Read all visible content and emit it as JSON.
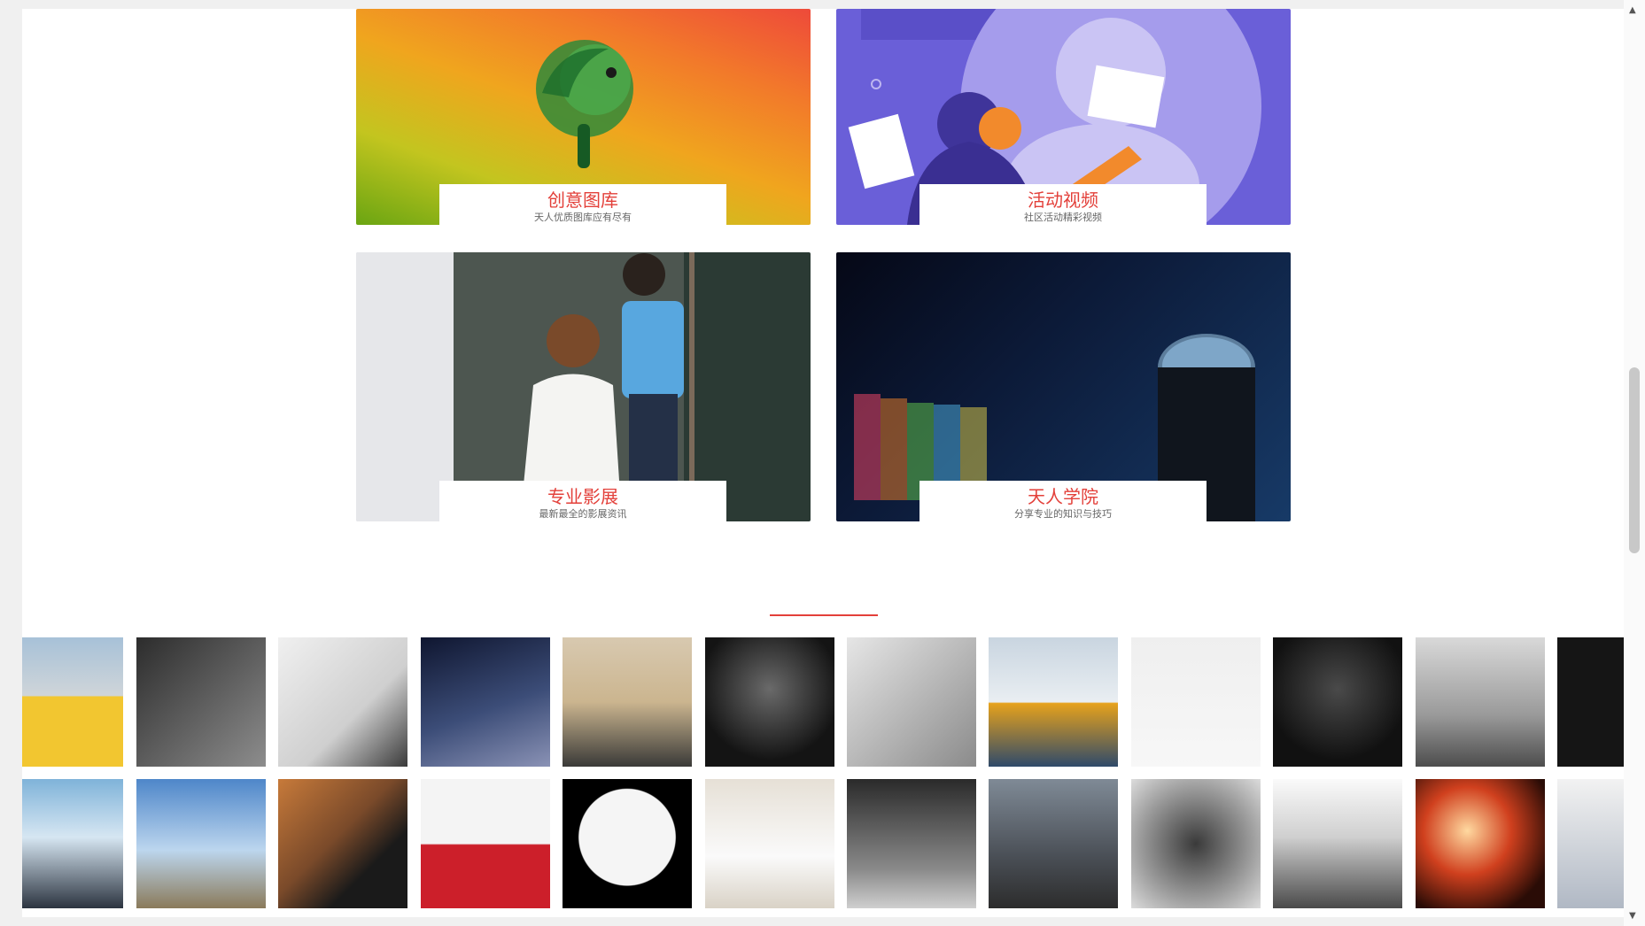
{
  "cards": [
    {
      "title": "创意图库",
      "subtitle": "天人优质图库应有尽有"
    },
    {
      "title": "活动视频",
      "subtitle": "社区活动精彩视频"
    },
    {
      "title": "专业影展",
      "subtitle": "最新最全的影展资讯"
    },
    {
      "title": "天人学院",
      "subtitle": "分享专业的知识与技巧"
    }
  ],
  "accent_color": "#e3403a",
  "member_photos_row1": [
    "man-yellow-shirt-stage",
    "double-exposure-profile",
    "man-sitting-table-bw",
    "milky-way-night",
    "masked-man-straw-hat",
    "man-holding-camera",
    "chef-in-kitchen-bw",
    "man-orange-jacket-snow",
    "woman-white-tshirt",
    "man-dark-portrait",
    "seaside-balloon-bw",
    "dark-sign"
  ],
  "member_photos_row2": [
    "diver-at-sea",
    "photographer-with-tripod",
    "smiling-man-hat",
    "woman-red-jacket",
    "silhouette-circle-camera",
    "woman-writing-desk",
    "man-with-camera-bw",
    "crouching-photographer",
    "silhouette-pattern",
    "double-exposure-city",
    "camera-red-light",
    "hand-holding-lens"
  ]
}
